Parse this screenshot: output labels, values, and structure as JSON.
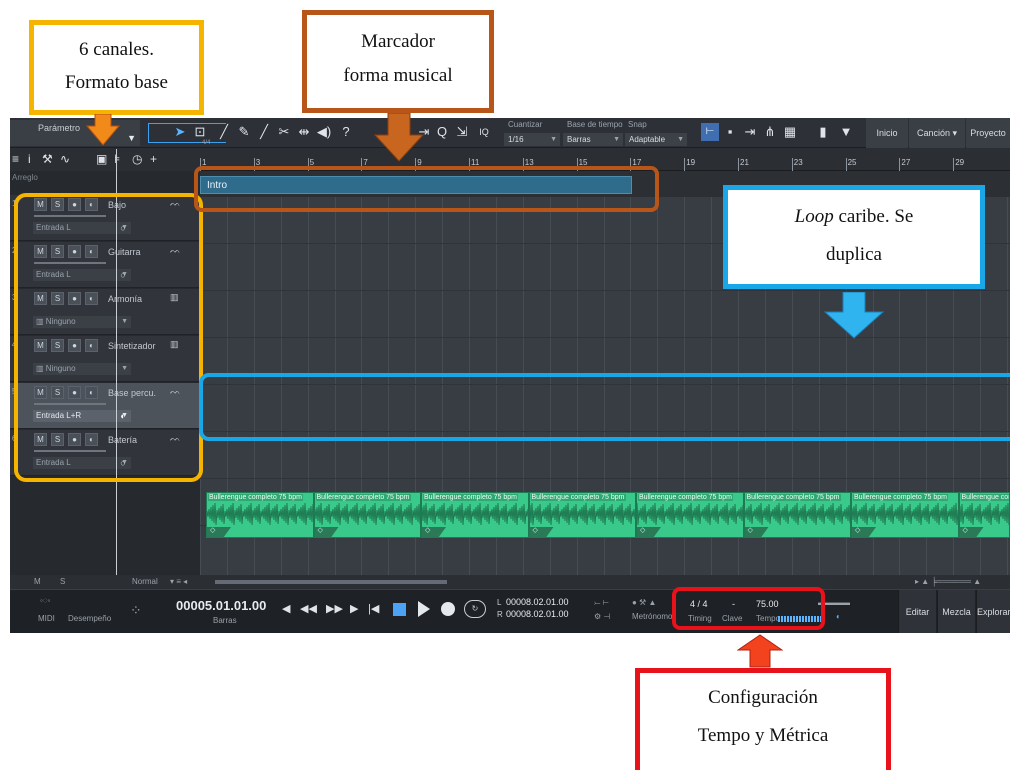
{
  "annotations": {
    "channels": {
      "line1": "6 canales.",
      "line2": "Formato base",
      "color": "#f5b400"
    },
    "marker": {
      "line1": "Marcador",
      "line2": "forma musical",
      "color": "#b8561a"
    },
    "loop": {
      "line1_italic": "Loop",
      "line1_rest": " caribe. Se",
      "line2": "duplica",
      "color": "#1aa7e8"
    },
    "tempo": {
      "line1": "Configuración",
      "line2": "Tempo y Métrica",
      "color": "#e8121b"
    }
  },
  "toolbar": {
    "param_label": "Parámetro",
    "quantize": {
      "label": "Cuantizar",
      "value": "1/16"
    },
    "timebase": {
      "label": "Base de tiempo",
      "value": "Barras"
    },
    "snap": {
      "label": "Snap",
      "value": "Adaptable"
    },
    "iq_label": "IQ",
    "nav": {
      "start": "Inicio",
      "song": "Canción",
      "project": "Proyecto"
    }
  },
  "arrangement": {
    "header_label": "Arreglo",
    "meter": "4/4",
    "ruler": [
      "1",
      "3",
      "5",
      "7",
      "9",
      "11",
      "13",
      "15",
      "17",
      "19",
      "21",
      "23",
      "25",
      "27",
      "29"
    ],
    "marker_label": "Intro"
  },
  "tracks": [
    {
      "num": "1",
      "name": "Bajo",
      "input": "Entrada L",
      "selected": false
    },
    {
      "num": "2",
      "name": "Guitarra",
      "input": "Entrada L",
      "selected": false
    },
    {
      "num": "3",
      "name": "Armonía",
      "input": "Ninguno",
      "selected": false
    },
    {
      "num": "4",
      "name": "Sintetizador",
      "input": "Ninguno",
      "selected": false
    },
    {
      "num": "5",
      "name": "Base percu.",
      "input": "Entrada L+R",
      "selected": true
    },
    {
      "num": "6",
      "name": "Batería",
      "input": "Entrada L",
      "selected": false
    }
  ],
  "track_buttons": {
    "mute": "M",
    "solo": "S",
    "record": "●",
    "monitor": "◐"
  },
  "clip": {
    "label": "Bullerengue completo 75 bpm",
    "repeat_count": 8
  },
  "bottom_bar": {
    "m": "M",
    "s": "S",
    "mode": "Normal"
  },
  "transport": {
    "midi": "MIDI",
    "performance": "Desempeño",
    "time": "00005.01.01.00",
    "time_unit": "Barras",
    "left_locator": "00008.02.01.00",
    "right_locator": "00008.02.01.00",
    "l": "L",
    "r": "R",
    "metronome": "Metrónomo",
    "timing_value": "4 / 4",
    "timing_label": "Timing",
    "key_value": "-",
    "key_label": "Clave",
    "tempo_value": "75.00",
    "tempo_label": "Tempo",
    "nav": {
      "edit": "Editar",
      "mix": "Mezcla",
      "browse": "Explorar"
    }
  }
}
